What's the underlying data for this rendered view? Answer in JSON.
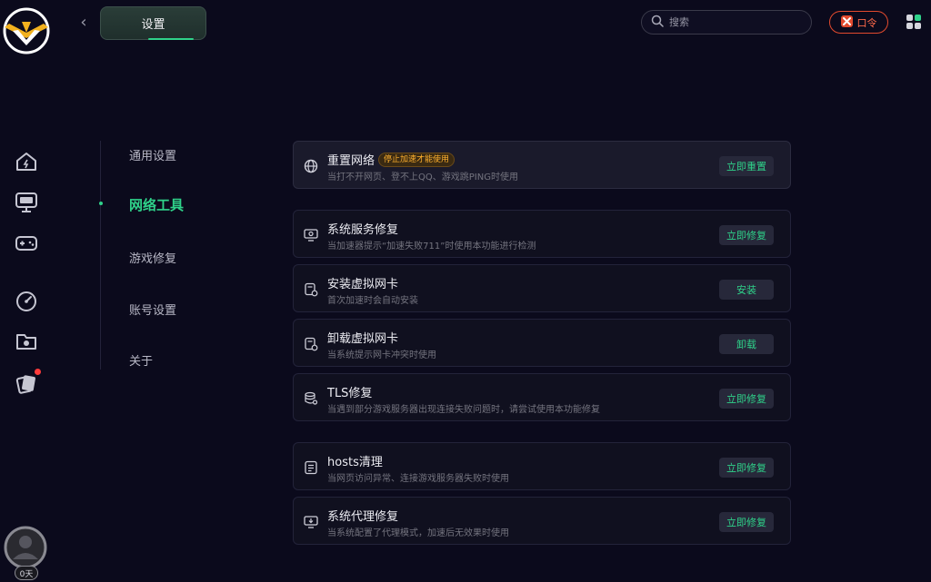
{
  "header": {
    "back_label": "‹",
    "tab_title": "设置",
    "search_placeholder": "搜索",
    "kouling_label": "口令"
  },
  "sidebar": {
    "icons": [
      "home-icon",
      "monitor-icon",
      "gamepad-icon",
      "speed-icon",
      "folder-icon",
      "cards-icon"
    ],
    "user_days": "0天"
  },
  "subnav": {
    "items": [
      {
        "label": "通用设置",
        "active": false
      },
      {
        "label": "网络工具",
        "active": true
      },
      {
        "label": "游戏修复",
        "active": false
      },
      {
        "label": "账号设置",
        "active": false
      },
      {
        "label": "关于",
        "active": false
      }
    ]
  },
  "cards": [
    {
      "title": "重置网络",
      "badge": "停止加速才能使用",
      "desc": "当打不开网页、登不上QQ、游戏跳PING时使用",
      "button": "立即重置",
      "icon": "globe-icon"
    },
    {
      "title": "系统服务修复",
      "desc": "当加速器提示“加速失败711”时使用本功能进行检测",
      "button": "立即修复",
      "icon": "monitor-gear-icon"
    },
    {
      "title": "安装虚拟网卡",
      "desc": "首次加速时会自动安装",
      "button": "安装",
      "icon": "network-card-icon"
    },
    {
      "title": "卸载虚拟网卡",
      "desc": "当系统提示网卡冲突时使用",
      "button": "卸载",
      "icon": "network-card-icon"
    },
    {
      "title": "TLS修复",
      "desc": "当遇到部分游戏服务器出现连接失败问题时，请尝试使用本功能修复",
      "button": "立即修复",
      "icon": "database-gear-icon"
    },
    {
      "title": "hosts清理",
      "desc": "当网页访问异常、连接游戏服务器失败时使用",
      "button": "立即修复",
      "icon": "document-icon"
    },
    {
      "title": "系统代理修复",
      "desc": "当系统配置了代理模式，加速后无效果时使用",
      "button": "立即修复",
      "icon": "monitor-proxy-icon"
    }
  ],
  "colors": {
    "accent": "#2fd28a",
    "badge": "#ffb02e",
    "kouling": "#e24a2e",
    "background": "#0b0a1c"
  }
}
